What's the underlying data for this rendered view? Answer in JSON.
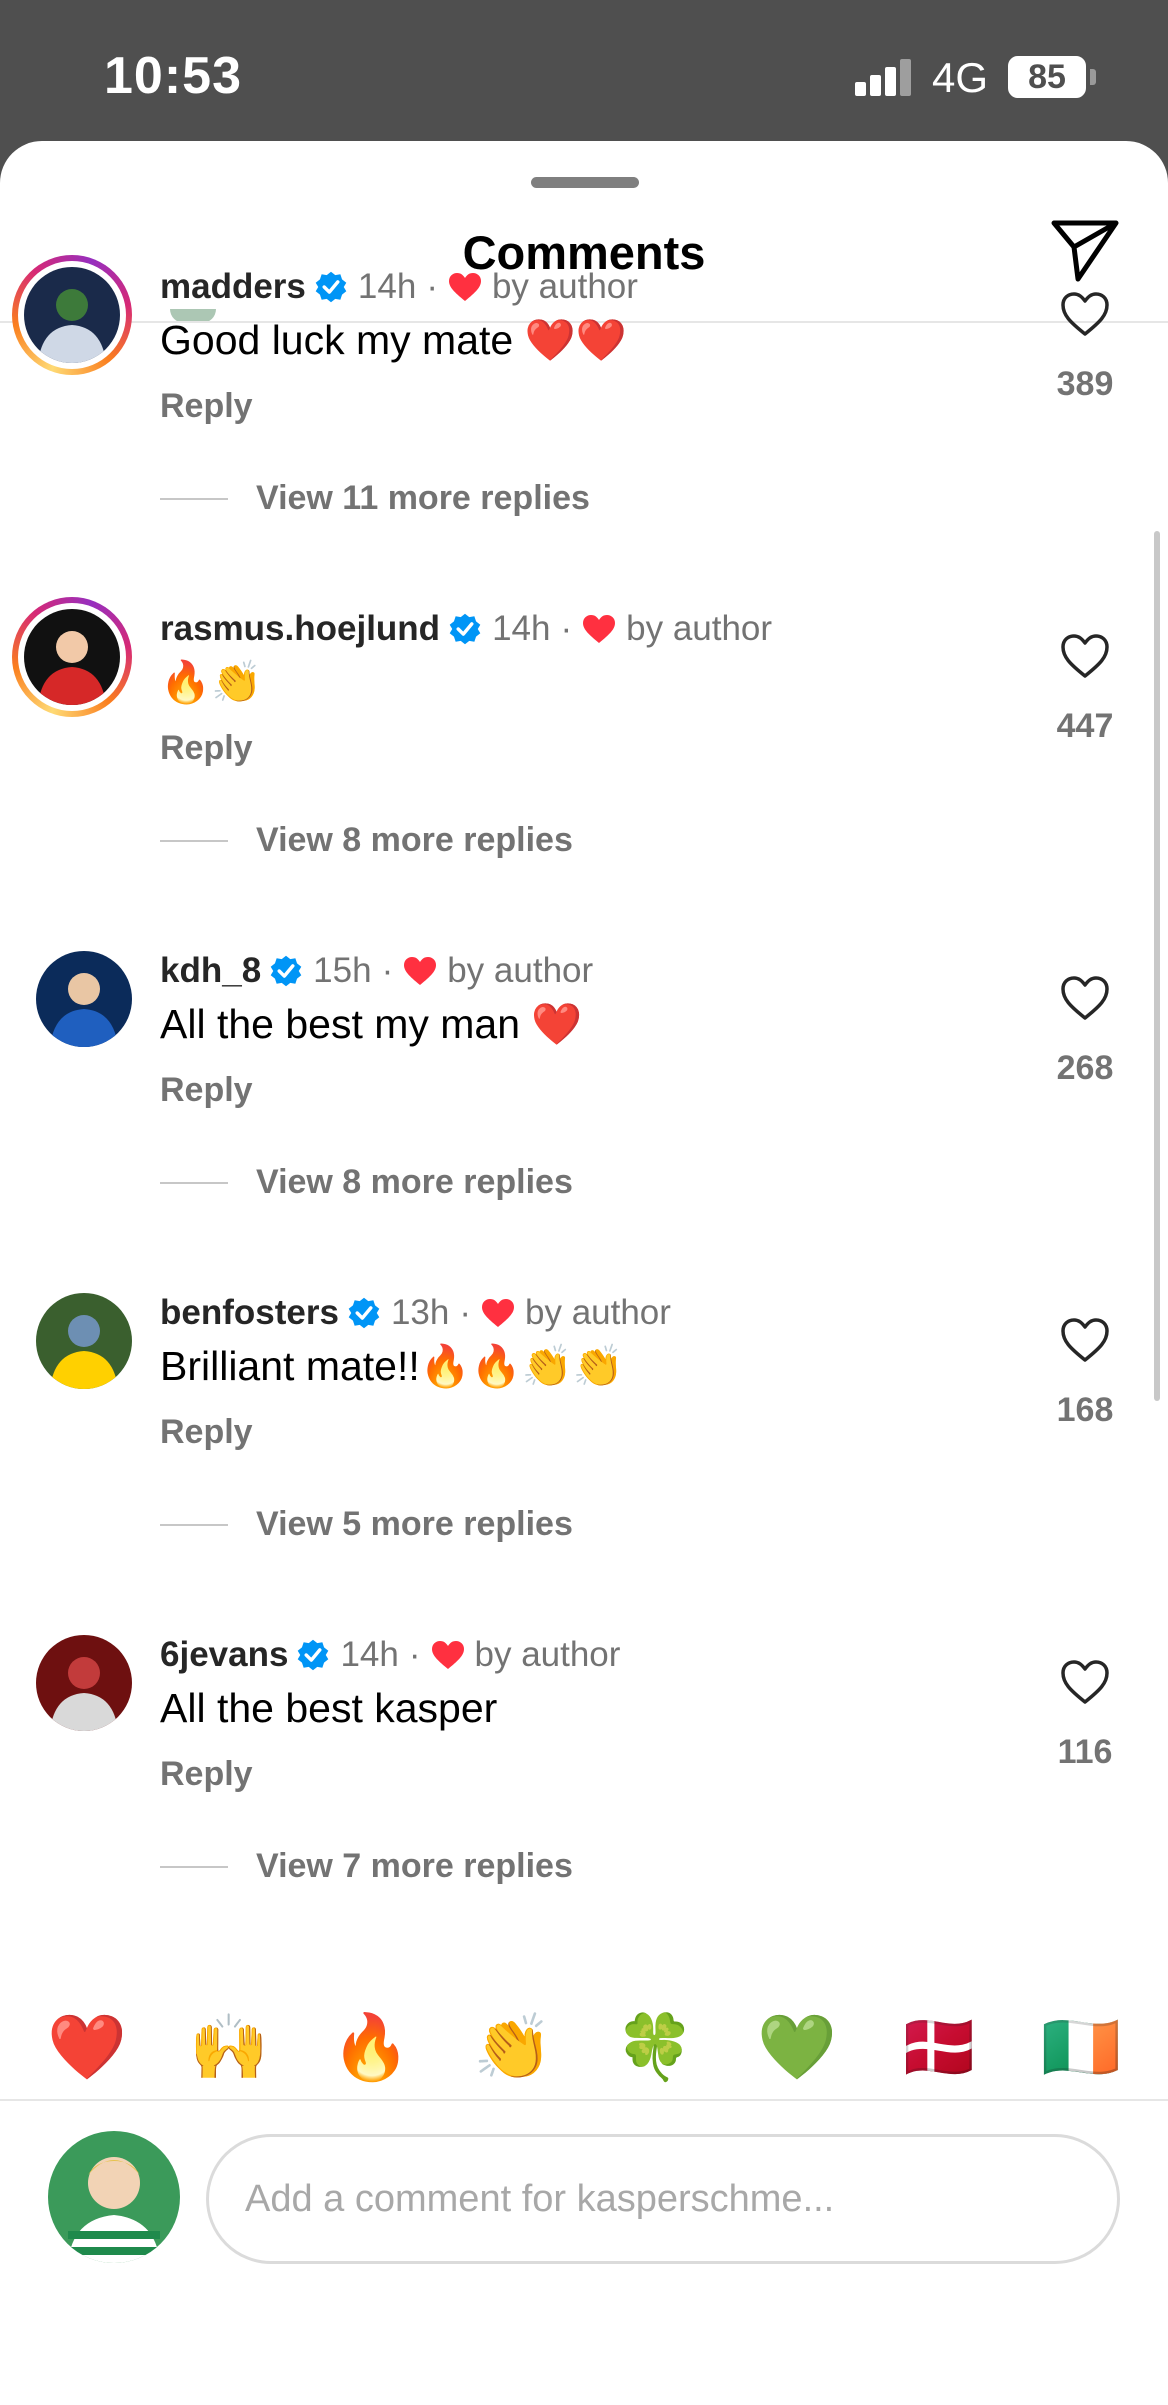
{
  "status_bar": {
    "time": "10:53",
    "network": "4G",
    "battery": "85"
  },
  "sheet": {
    "title": "Comments",
    "share_icon": "paper-plane-icon"
  },
  "comments": [
    {
      "username": "madders",
      "time": "14h",
      "liked_by": "by author",
      "text": "Good luck my mate ❤️❤️",
      "reply_label": "Reply",
      "view_replies": "View 11 more replies",
      "likes": "389",
      "ring": true
    },
    {
      "username": "rasmus.hoejlund",
      "time": "14h",
      "liked_by": "by author",
      "text": "🔥👏",
      "reply_label": "Reply",
      "view_replies": "View 8 more replies",
      "likes": "447",
      "ring": true
    },
    {
      "username": "kdh_8",
      "time": "15h",
      "liked_by": "by author",
      "text": "All the best my man ❤️",
      "reply_label": "Reply",
      "view_replies": "View 8 more replies",
      "likes": "268",
      "ring": false
    },
    {
      "username": "benfosters",
      "time": "13h",
      "liked_by": "by author",
      "text": "Brilliant mate!!🔥🔥👏👏",
      "reply_label": "Reply",
      "view_replies": "View 5 more replies",
      "likes": "168",
      "ring": false
    },
    {
      "username": "6jevans",
      "time": "14h",
      "liked_by": "by author",
      "text": "All the best kasper",
      "reply_label": "Reply",
      "view_replies": "View 7 more replies",
      "likes": "116",
      "ring": false
    }
  ],
  "quick_emojis": [
    "❤️",
    "🙌",
    "🔥",
    "👏",
    "🍀",
    "💚",
    "🇩🇰",
    "🇮🇪"
  ],
  "composer": {
    "placeholder": "Add a comment for kasperschme..."
  },
  "colors": {
    "like_red": "#ff3040",
    "verified_blue": "#0095f6",
    "muted": "#737373"
  }
}
